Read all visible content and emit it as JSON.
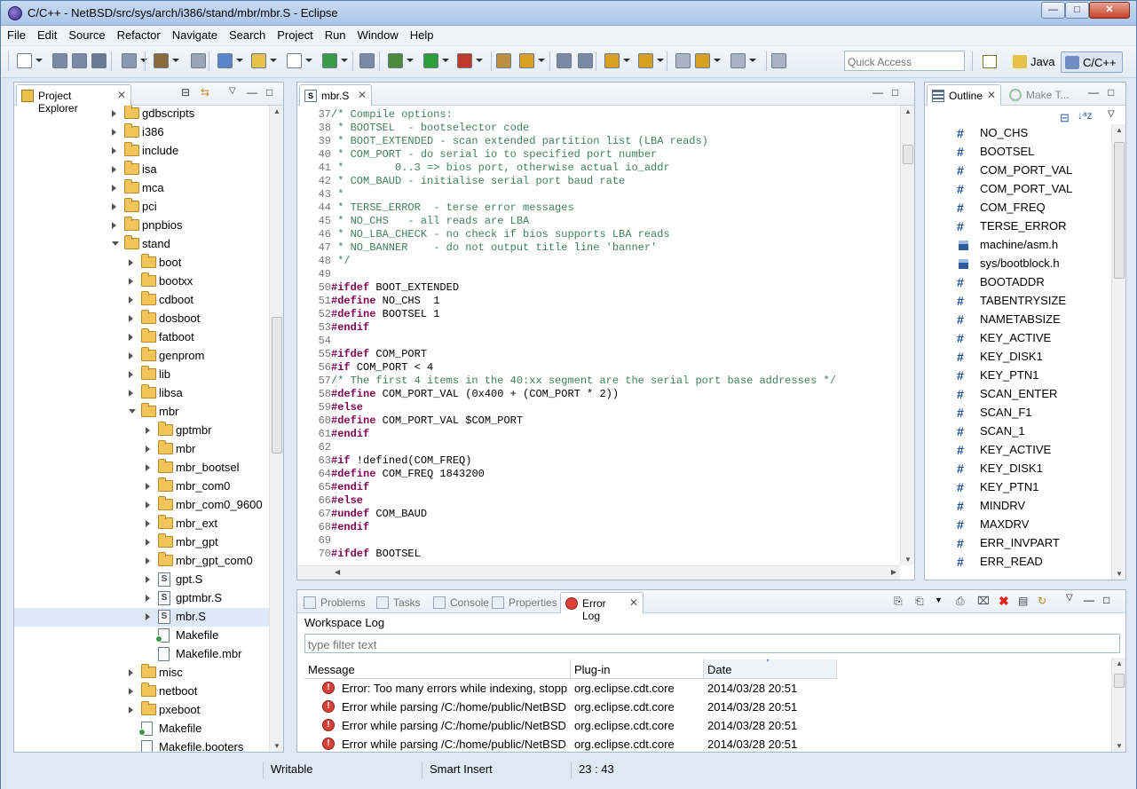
{
  "window": {
    "title": "C/C++ - NetBSD/src/sys/arch/i386/stand/mbr/mbr.S - Eclipse"
  },
  "menu": [
    "File",
    "Edit",
    "Source",
    "Refactor",
    "Navigate",
    "Search",
    "Project",
    "Run",
    "Window",
    "Help"
  ],
  "quick_access": {
    "placeholder": "Quick Access"
  },
  "perspectives": [
    {
      "label": "Java",
      "active": false
    },
    {
      "label": "C/C++",
      "active": true
    }
  ],
  "project_explorer": {
    "tab_label": "Project Explorer",
    "items": [
      {
        "label": "gdbscripts",
        "kind": "folder",
        "depth": 0,
        "open": false
      },
      {
        "label": "i386",
        "kind": "folder",
        "depth": 0,
        "open": false
      },
      {
        "label": "include",
        "kind": "folder",
        "depth": 0,
        "open": false
      },
      {
        "label": "isa",
        "kind": "folder",
        "depth": 0,
        "open": false
      },
      {
        "label": "mca",
        "kind": "folder",
        "depth": 0,
        "open": false
      },
      {
        "label": "pci",
        "kind": "folder",
        "depth": 0,
        "open": false
      },
      {
        "label": "pnpbios",
        "kind": "folder",
        "depth": 0,
        "open": false
      },
      {
        "label": "stand",
        "kind": "folder",
        "depth": 0,
        "open": true
      },
      {
        "label": "boot",
        "kind": "folder",
        "depth": 1,
        "open": false
      },
      {
        "label": "bootxx",
        "kind": "folder",
        "depth": 1,
        "open": false
      },
      {
        "label": "cdboot",
        "kind": "folder",
        "depth": 1,
        "open": false
      },
      {
        "label": "dosboot",
        "kind": "folder",
        "depth": 1,
        "open": false
      },
      {
        "label": "fatboot",
        "kind": "folder",
        "depth": 1,
        "open": false
      },
      {
        "label": "genprom",
        "kind": "folder",
        "depth": 1,
        "open": false
      },
      {
        "label": "lib",
        "kind": "folder",
        "depth": 1,
        "open": false
      },
      {
        "label": "libsa",
        "kind": "folder",
        "depth": 1,
        "open": false
      },
      {
        "label": "mbr",
        "kind": "folder",
        "depth": 1,
        "open": true
      },
      {
        "label": "gptmbr",
        "kind": "folder",
        "depth": 2,
        "open": false
      },
      {
        "label": "mbr",
        "kind": "folder",
        "depth": 2,
        "open": false
      },
      {
        "label": "mbr_bootsel",
        "kind": "folder",
        "depth": 2,
        "open": false
      },
      {
        "label": "mbr_com0",
        "kind": "folder",
        "depth": 2,
        "open": false
      },
      {
        "label": "mbr_com0_9600",
        "kind": "folder",
        "depth": 2,
        "open": false
      },
      {
        "label": "mbr_ext",
        "kind": "folder",
        "depth": 2,
        "open": false
      },
      {
        "label": "mbr_gpt",
        "kind": "folder",
        "depth": 2,
        "open": false
      },
      {
        "label": "mbr_gpt_com0",
        "kind": "folder",
        "depth": 2,
        "open": false
      },
      {
        "label": "gpt.S",
        "kind": "sfile",
        "depth": 2,
        "open": false
      },
      {
        "label": "gptmbr.S",
        "kind": "sfile",
        "depth": 2,
        "open": false
      },
      {
        "label": "mbr.S",
        "kind": "sfile",
        "depth": 2,
        "open": false,
        "selected": true
      },
      {
        "label": "Makefile",
        "kind": "make",
        "depth": 2
      },
      {
        "label": "Makefile.mbr",
        "kind": "plain",
        "depth": 2
      },
      {
        "label": "misc",
        "kind": "folder",
        "depth": 1,
        "open": false
      },
      {
        "label": "netboot",
        "kind": "folder",
        "depth": 1,
        "open": false
      },
      {
        "label": "pxeboot",
        "kind": "folder",
        "depth": 1,
        "open": false
      },
      {
        "label": "Makefile",
        "kind": "make",
        "depth": 1
      },
      {
        "label": "Makefile.booters",
        "kind": "plain",
        "depth": 1
      }
    ]
  },
  "editor": {
    "tab_label": "mbr.S",
    "lines": [
      {
        "n": "37",
        "t": "/* Compile options:",
        "k": "com"
      },
      {
        "n": "38",
        "t": " * BOOTSEL  - bootselector code",
        "k": "com"
      },
      {
        "n": "39",
        "t": " * BOOT_EXTENDED - scan extended partition list (LBA reads)",
        "k": "com"
      },
      {
        "n": "40",
        "t": " * COM_PORT - do serial io to specified port number",
        "k": "com"
      },
      {
        "n": "41",
        "t": " *        0..3 => bios port, otherwise actual io_addr",
        "k": "com"
      },
      {
        "n": "42",
        "t": " * COM_BAUD - initialise serial port baud rate",
        "k": "com"
      },
      {
        "n": "43",
        "t": " *",
        "k": "com"
      },
      {
        "n": "44",
        "t": " * TERSE_ERROR  - terse error messages",
        "k": "com"
      },
      {
        "n": "45",
        "t": " * NO_CHS   - all reads are LBA",
        "k": "com"
      },
      {
        "n": "46",
        "t": " * NO_LBA_CHECK - no check if bios supports LBA reads",
        "k": "com"
      },
      {
        "n": "47",
        "t": " * NO_BANNER    - do not output title line 'banner'",
        "k": "com"
      },
      {
        "n": "48",
        "t": " */",
        "k": "com"
      },
      {
        "n": "49",
        "t": "",
        "k": "txt"
      },
      {
        "n": "50",
        "t": "#ifdef",
        "r": " BOOT_EXTENDED",
        "k": "pre"
      },
      {
        "n": "51",
        "t": "#define",
        "r": " NO_CHS  1",
        "k": "pre"
      },
      {
        "n": "52",
        "t": "#define",
        "r": " BOOTSEL 1",
        "k": "pre"
      },
      {
        "n": "53",
        "t": "#endif",
        "k": "pre"
      },
      {
        "n": "54",
        "t": "",
        "k": "txt"
      },
      {
        "n": "55",
        "t": "#ifdef",
        "r": " COM_PORT",
        "k": "pre"
      },
      {
        "n": "56",
        "t": "#if",
        "r": " COM_PORT < 4",
        "k": "pre"
      },
      {
        "n": "57",
        "t": "/* The first 4 items in the 40:xx segment are the serial port base addresses */",
        "k": "com"
      },
      {
        "n": "58",
        "t": "#define",
        "r": " COM_PORT_VAL (0x400 + (COM_PORT * 2))",
        "k": "pre"
      },
      {
        "n": "59",
        "t": "#else",
        "k": "pre"
      },
      {
        "n": "60",
        "t": "#define",
        "r": " COM_PORT_VAL $COM_PORT",
        "k": "pre"
      },
      {
        "n": "61",
        "t": "#endif",
        "k": "pre"
      },
      {
        "n": "62",
        "t": "",
        "k": "txt"
      },
      {
        "n": "63",
        "t": "#if",
        "r": " !defined(COM_FREQ)",
        "k": "pre"
      },
      {
        "n": "64",
        "t": "#define",
        "r": " COM_FREQ 1843200",
        "k": "pre"
      },
      {
        "n": "65",
        "t": "#endif",
        "k": "pre"
      },
      {
        "n": "66",
        "t": "#else",
        "k": "pre"
      },
      {
        "n": "67",
        "t": "#undef",
        "r": " COM_BAUD",
        "k": "pre"
      },
      {
        "n": "68",
        "t": "#endif",
        "k": "pre"
      },
      {
        "n": "69",
        "t": "",
        "k": "txt"
      },
      {
        "n": "70",
        "t": "#ifdef",
        "r": " BOOTSEL",
        "k": "pre"
      }
    ]
  },
  "outline": {
    "tab_label": "Outline",
    "other_tab": "Make T...",
    "items": [
      {
        "label": "NO_CHS",
        "kind": "macro"
      },
      {
        "label": "BOOTSEL",
        "kind": "macro"
      },
      {
        "label": "COM_PORT_VAL",
        "kind": "macro"
      },
      {
        "label": "COM_PORT_VAL",
        "kind": "macro"
      },
      {
        "label": "COM_FREQ",
        "kind": "macro"
      },
      {
        "label": "TERSE_ERROR",
        "kind": "macro"
      },
      {
        "label": "machine/asm.h",
        "kind": "include"
      },
      {
        "label": "sys/bootblock.h",
        "kind": "include"
      },
      {
        "label": "BOOTADDR",
        "kind": "macro"
      },
      {
        "label": "TABENTRYSIZE",
        "kind": "macro"
      },
      {
        "label": "NAMETABSIZE",
        "kind": "macro"
      },
      {
        "label": "KEY_ACTIVE",
        "kind": "macro"
      },
      {
        "label": "KEY_DISK1",
        "kind": "macro"
      },
      {
        "label": "KEY_PTN1",
        "kind": "macro"
      },
      {
        "label": "SCAN_ENTER",
        "kind": "macro"
      },
      {
        "label": "SCAN_F1",
        "kind": "macro"
      },
      {
        "label": "SCAN_1",
        "kind": "macro"
      },
      {
        "label": "KEY_ACTIVE",
        "kind": "macro"
      },
      {
        "label": "KEY_DISK1",
        "kind": "macro"
      },
      {
        "label": "KEY_PTN1",
        "kind": "macro"
      },
      {
        "label": "MINDRV",
        "kind": "macro"
      },
      {
        "label": "MAXDRV",
        "kind": "macro"
      },
      {
        "label": "ERR_INVPART",
        "kind": "macro"
      },
      {
        "label": "ERR_READ",
        "kind": "macro"
      }
    ]
  },
  "bottom_panel": {
    "tabs": [
      "Problems",
      "Tasks",
      "Console",
      "Properties",
      "Error Log"
    ],
    "active_tab": "Error Log",
    "title": "Workspace Log",
    "filter_placeholder": "type filter text",
    "columns": [
      "Message",
      "Plug-in",
      "Date"
    ],
    "rows": [
      {
        "message": "Error: Too many errors while indexing, stopp",
        "plugin": "org.eclipse.cdt.core",
        "date": "2014/03/28 20:51"
      },
      {
        "message": "Error while parsing /C:/home/public/NetBSD",
        "plugin": "org.eclipse.cdt.core",
        "date": "2014/03/28 20:51"
      },
      {
        "message": "Error while parsing /C:/home/public/NetBSD",
        "plugin": "org.eclipse.cdt.core",
        "date": "2014/03/28 20:51"
      },
      {
        "message": "Error while parsing /C:/home/public/NetBSD",
        "plugin": "org.eclipse.cdt.core",
        "date": "2014/03/28 20:51"
      }
    ]
  },
  "status_bar": {
    "mode": "Writable",
    "insert": "Smart Insert",
    "position": "23 : 43"
  }
}
